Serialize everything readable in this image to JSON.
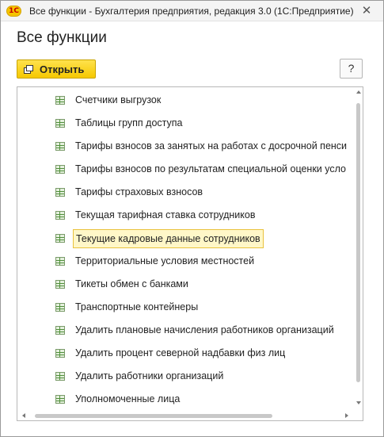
{
  "window": {
    "title": "Все функции - Бухгалтерия предприятия, редакция 3.0  (1С:Предприятие)",
    "logo_text": "1С",
    "close_glyph": "✕"
  },
  "page": {
    "title": "Все функции"
  },
  "toolbar": {
    "open_label": "Открыть",
    "help_label": "?"
  },
  "list": {
    "items": [
      {
        "label": "Счетчики выгрузок",
        "icon": "table-icon"
      },
      {
        "label": "Таблицы групп доступа",
        "icon": "table-icon"
      },
      {
        "label": "Тарифы взносов за занятых на работах с досрочной пенси",
        "icon": "table-icon"
      },
      {
        "label": "Тарифы взносов по результатам специальной оценки усло",
        "icon": "table-icon"
      },
      {
        "label": "Тарифы страховых взносов",
        "icon": "table-icon"
      },
      {
        "label": "Текущая тарифная ставка сотрудников",
        "icon": "table-icon"
      },
      {
        "label": "Текущие кадровые данные сотрудников",
        "icon": "table-icon",
        "selected": true
      },
      {
        "label": "Территориальные условия местностей",
        "icon": "table-icon"
      },
      {
        "label": "Тикеты обмен с банками",
        "icon": "table-icon"
      },
      {
        "label": "Транспортные контейнеры",
        "icon": "table-icon"
      },
      {
        "label": "Удалить плановые начисления работников организаций",
        "icon": "table-icon"
      },
      {
        "label": "Удалить процент северной надбавки физ лиц",
        "icon": "table-icon"
      },
      {
        "label": "Удалить работники организаций",
        "icon": "table-icon"
      },
      {
        "label": "Уполномоченные лица",
        "icon": "table-icon"
      }
    ]
  },
  "colors": {
    "accent_button": "#f5c800",
    "selection_border": "#e9c23c",
    "selection_fill": "#fff7c8",
    "table_icon": "#4f8f3a"
  }
}
